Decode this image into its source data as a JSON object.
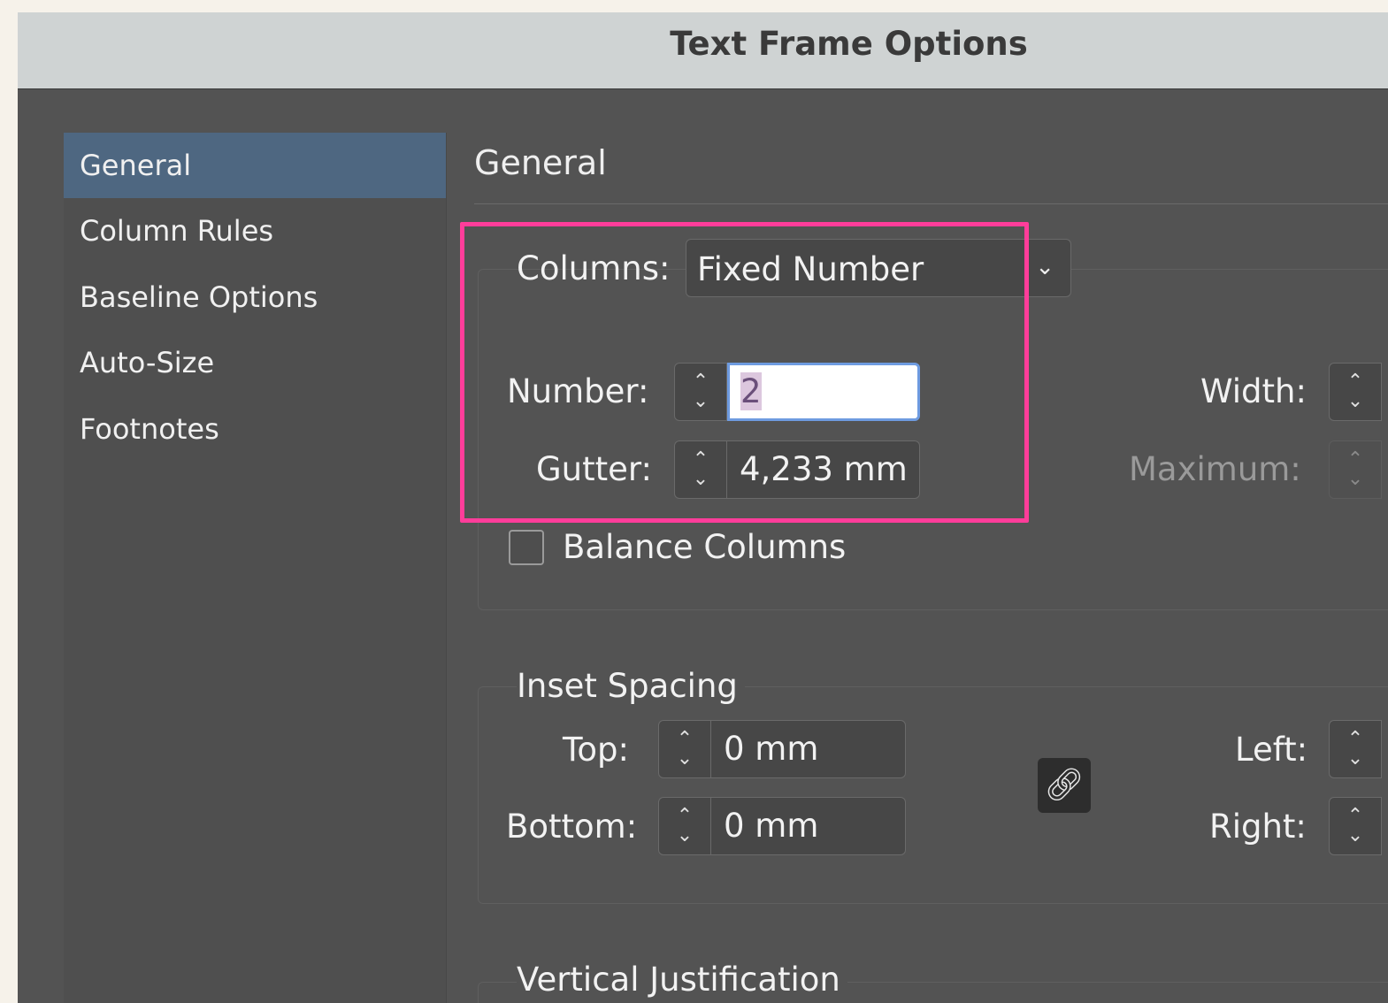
{
  "window": {
    "title": "Text Frame Options"
  },
  "sidebar": {
    "items": [
      {
        "label": "General",
        "active": true
      },
      {
        "label": "Column Rules",
        "active": false
      },
      {
        "label": "Baseline Options",
        "active": false
      },
      {
        "label": "Auto-Size",
        "active": false
      },
      {
        "label": "Footnotes",
        "active": false
      }
    ]
  },
  "main": {
    "title": "General",
    "columns": {
      "label": "Columns:",
      "value": "Fixed Number",
      "number_label": "Number:",
      "number_value": "2",
      "gutter_label": "Gutter:",
      "gutter_value": "4,233 mm",
      "width_label": "Width:",
      "maximum_label": "Maximum:",
      "balance_label": "Balance Columns",
      "balance_checked": false
    },
    "inset": {
      "title": "Inset Spacing",
      "top_label": "Top:",
      "top_value": "0 mm",
      "bottom_label": "Bottom:",
      "bottom_value": "0 mm",
      "left_label": "Left:",
      "right_label": "Right:"
    },
    "vertical": {
      "title": "Vertical Justification"
    }
  },
  "icons": {
    "chevron": "chevron-down-icon",
    "stepper": "stepper-icon",
    "link": "chain-link-icon"
  },
  "colors": {
    "sidebar_active": "#4e6781",
    "highlight": "#ff3d9a",
    "dialog_bg": "#535353"
  }
}
